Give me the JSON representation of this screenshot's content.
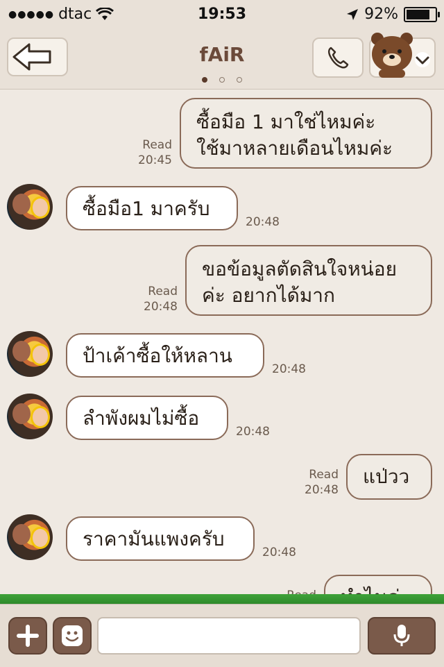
{
  "status": {
    "carrier": "dtac",
    "time": "19:53",
    "battery": "92%",
    "battery_level": 0.92
  },
  "header": {
    "title": "fAiR",
    "page_count": 3,
    "active_page": 1
  },
  "messages": [
    {
      "side": "sent",
      "lines": [
        "ซื้อมือ 1 มาใช่ไหมค่ะ",
        "ใช้มาหลายเดือนไหมค่ะ"
      ],
      "read": "Read",
      "time": "20:45"
    },
    {
      "side": "received",
      "lines": [
        "ซื้อมือ1 มาครับ"
      ],
      "time": "20:48"
    },
    {
      "side": "sent",
      "lines": [
        "ขอข้อมูลตัดสินใจหน่อย",
        "ค่ะ อยากได้มาก"
      ],
      "read": "Read",
      "time": "20:48"
    },
    {
      "side": "received",
      "lines": [
        "ป้าเค้าซื้อให้หลาน"
      ],
      "time": "20:48"
    },
    {
      "side": "received",
      "lines": [
        "ลำพังผมไม่ซื้อ"
      ],
      "time": "20:48"
    },
    {
      "side": "sent",
      "lines": [
        "แป่วว"
      ],
      "read": "Read",
      "time": "20:48"
    },
    {
      "side": "received",
      "lines": [
        "ราคามันแพงครับ"
      ],
      "time": "20:48"
    },
    {
      "side": "sent",
      "lines": [
        "ทำไมค่ะ"
      ],
      "read": "Read",
      "time": ""
    }
  ],
  "input": {
    "placeholder": "",
    "value": ""
  },
  "icons": {
    "back": "back-arrow-icon",
    "call": "phone-icon",
    "sticker": "brown-bear-icon",
    "chevron": "chevron-down-icon",
    "add": "plus-icon",
    "emoji": "smile-icon",
    "mic": "microphone-icon"
  },
  "colors": {
    "bubble_border": "#8a6a58",
    "accent": "#7a5a4a",
    "title": "#6b4a3a"
  }
}
